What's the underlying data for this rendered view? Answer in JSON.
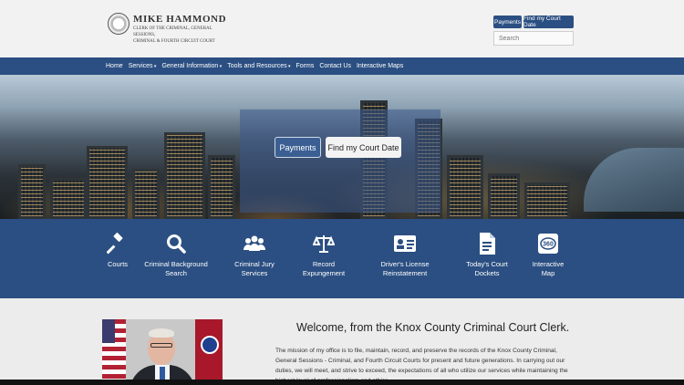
{
  "header": {
    "brand_name": "MIKE HAMMOND",
    "brand_subtitle_1": "Clerk of the Criminal, General Sessions,",
    "brand_subtitle_2": "Criminal & Fourth Circuit Court",
    "payments_label": "Payments",
    "find_court_date_label": "Find my Court Date",
    "search_placeholder": "Search"
  },
  "nav": {
    "items": [
      {
        "label": "Home"
      },
      {
        "label": "Services"
      },
      {
        "label": "General Information"
      },
      {
        "label": "Tools and Resources"
      },
      {
        "label": "Forms"
      },
      {
        "label": "Contact Us"
      },
      {
        "label": "Interactive Maps"
      }
    ]
  },
  "hero": {
    "payments_label": "Payments",
    "find_court_date_label": "Find my Court Date"
  },
  "services": [
    {
      "label_1": "Courts",
      "label_2": "",
      "icon": "gavel-icon"
    },
    {
      "label_1": "Criminal Background",
      "label_2": "Search",
      "icon": "search-icon"
    },
    {
      "label_1": "Criminal Jury",
      "label_2": "Services",
      "icon": "users-icon"
    },
    {
      "label_1": "Record",
      "label_2": "Expungement",
      "icon": "scales-icon"
    },
    {
      "label_1": "Driver's License",
      "label_2": "Reinstatement",
      "icon": "id-card-icon"
    },
    {
      "label_1": "Today's Court",
      "label_2": "Dockets",
      "icon": "document-icon"
    },
    {
      "label_1": "Interactive",
      "label_2": "Map",
      "icon": "360-map-icon"
    }
  ],
  "welcome": {
    "title": "Welcome, from the Knox County Criminal Court Clerk.",
    "body": "The mission of my office is to file, maintain, record, and preserve the records of the Knox County Criminal, General Sessions - Criminal, and Fourth Circuit Courts for present and future generations. In carrying out our duties, we will meet, and strive to exceed, the expectations of all who utilize our services while maintaining the highest level of professionalism and ethics."
  },
  "colors": {
    "primary_blue": "#2b4f82",
    "header_bg": "#f2f2f2",
    "page_bg": "#ececec"
  }
}
